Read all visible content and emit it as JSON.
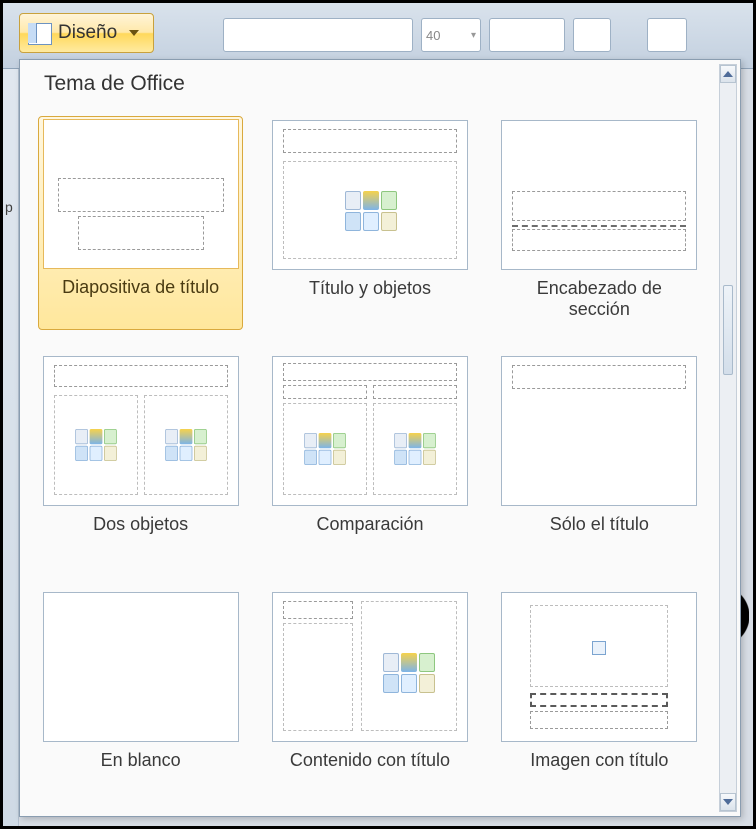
{
  "ribbon": {
    "design_button_label": "Diseño",
    "font_size_value": "40"
  },
  "gallery": {
    "header": "Tema de Office",
    "layouts": [
      {
        "label": "Diapositiva de título",
        "selected": true
      },
      {
        "label": "Título y objetos",
        "selected": false
      },
      {
        "label": "Encabezado de sección",
        "selected": false
      },
      {
        "label": "Dos objetos",
        "selected": false
      },
      {
        "label": "Comparación",
        "selected": false
      },
      {
        "label": "Sólo el título",
        "selected": false
      },
      {
        "label": "En blanco",
        "selected": false
      },
      {
        "label": "Contenido con título",
        "selected": false
      },
      {
        "label": "Imagen con título",
        "selected": false
      }
    ]
  },
  "left_strip_label": "p"
}
